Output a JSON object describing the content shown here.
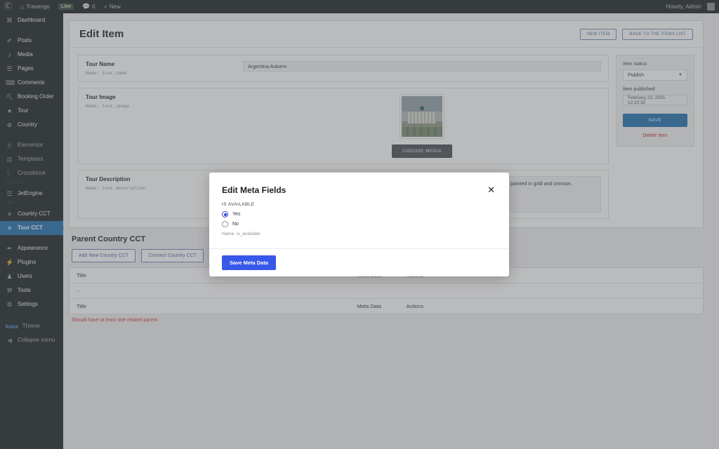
{
  "adminbar": {
    "logo_icon": "wordpress-logo-icon",
    "site_icon": "home-icon",
    "site_name": "Travengo",
    "live_badge": "Live",
    "comments_icon": "comment-icon",
    "comments_count": "0",
    "new_icon": "plus-icon",
    "new_label": "New",
    "howdy": "Howdy, Admin"
  },
  "sidebar": {
    "items": [
      {
        "label": "Dashboard",
        "icon": "dashboard-icon",
        "name": "dashboard",
        "state": "normal",
        "gap_after": true
      },
      {
        "label": "Posts",
        "icon": "pin-icon",
        "name": "posts",
        "state": "normal"
      },
      {
        "label": "Media",
        "icon": "media-icon",
        "name": "media",
        "state": "normal"
      },
      {
        "label": "Pages",
        "icon": "pages-icon",
        "name": "pages",
        "state": "normal"
      },
      {
        "label": "Comments",
        "icon": "comment-icon",
        "name": "comments",
        "state": "normal"
      },
      {
        "label": "Booking Order",
        "icon": "cart-icon",
        "name": "booking-order",
        "state": "normal"
      },
      {
        "label": "Tour",
        "icon": "star-icon",
        "name": "tour",
        "state": "normal"
      },
      {
        "label": "Country",
        "icon": "globe-icon",
        "name": "country",
        "state": "normal",
        "gap_after": true
      },
      {
        "label": "Elementor",
        "icon": "elementor-icon",
        "name": "elementor",
        "state": "dim"
      },
      {
        "label": "Templates",
        "icon": "templates-icon",
        "name": "templates",
        "state": "dim"
      },
      {
        "label": "Crocoblock",
        "icon": "crocoblock-icon",
        "name": "crocoblock",
        "state": "dim",
        "sep_after": "PLUGINS"
      },
      {
        "label": "JetEngine",
        "icon": "jetengine-icon",
        "name": "jetengine",
        "state": "normal",
        "sep_after": "CPT"
      },
      {
        "label": "Country CCT",
        "icon": "list-icon",
        "name": "country-cct",
        "state": "normal"
      },
      {
        "label": "Tour CCT",
        "icon": "list-icon",
        "name": "tour-cct",
        "state": "current",
        "gap_after": true
      },
      {
        "label": "Appearance",
        "icon": "brush-icon",
        "name": "appearance",
        "state": "normal"
      },
      {
        "label": "Plugins",
        "icon": "plug-icon",
        "name": "plugins",
        "state": "normal"
      },
      {
        "label": "Users",
        "icon": "users-icon",
        "name": "users",
        "state": "normal"
      },
      {
        "label": "Tools",
        "icon": "tools-icon",
        "name": "tools",
        "state": "normal"
      },
      {
        "label": "Settings",
        "icon": "settings-icon",
        "name": "settings",
        "state": "normal",
        "gap_after": true
      }
    ],
    "theme_brand": "kava",
    "theme_label": "Theme",
    "collapse_label": "Collapse menu",
    "collapse_icon": "collapse-arrow-icon"
  },
  "page": {
    "title": "Edit Item",
    "new_item_button": "NEW ITEM",
    "back_button": "BACK TO THE ITEMS LIST"
  },
  "fields": {
    "tour_name": {
      "label": "Tour Name",
      "name_hint": "Name: tour_name",
      "value": "Argentina Autumn"
    },
    "tour_image": {
      "label": "Tour Image",
      "name_hint": "Name: tour_image",
      "choose_media_button": "CHOOSE MEDIA",
      "thumbnail_alt": "aerial-city-dome-building"
    },
    "tour_description": {
      "label": "Tour Description",
      "name_hint": "Name: tour_description",
      "value": "Discover the beauty of Argentina in autumn, from the vineyards of Mendoza to the awe-inspiring Patagonian landscapes painted in gold and crimson."
    }
  },
  "publish_box": {
    "status_label": "Item status",
    "status_value": "Publish",
    "published_label": "Item published",
    "published_value": "February 23, 2025 12:20:32",
    "save_button": "SAVE",
    "delete_link": "Delete item"
  },
  "relations": {
    "title": "Parent Country CCT",
    "add_button": "Add New Country CCT",
    "connect_button": "Connect Country CCT",
    "columns": [
      "Title",
      "Meta Data",
      "Actions"
    ],
    "empty_cell": "--",
    "warning": "Should have at least one related parent."
  },
  "modal": {
    "title": "Edit Meta Fields",
    "close_icon": "close-icon",
    "legend": "IS AVAILABLE",
    "options": [
      {
        "label": "Yes",
        "checked": true
      },
      {
        "label": "No",
        "checked": false
      }
    ],
    "name_hint": "Name: is_available",
    "save_button": "Save Meta Data"
  },
  "colors": {
    "admin_dark": "#1d2327",
    "current_menu": "#2271b1",
    "modal_primary": "#3858e9",
    "danger": "#d63638",
    "radio_checked": "#2b42d6"
  }
}
